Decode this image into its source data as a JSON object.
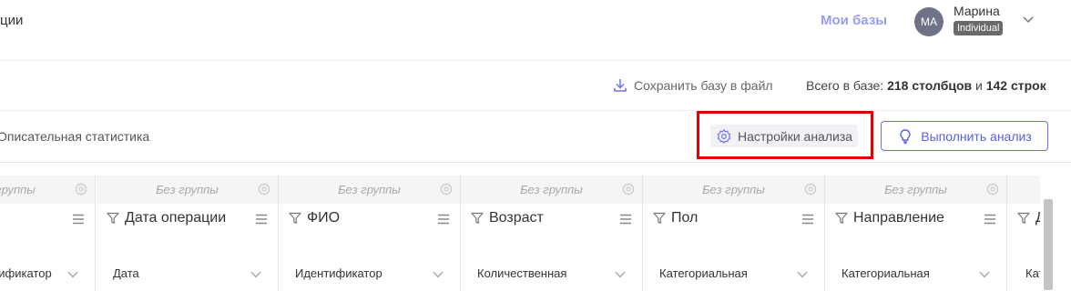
{
  "header": {
    "nav_fragment": "ции",
    "my_databases": "Мои базы",
    "user": {
      "initials": "MA",
      "name": "Марина",
      "plan": "Individual"
    }
  },
  "infobar": {
    "save_label": "Сохранить базу в файл",
    "totals_prefix": "Всего в базе: ",
    "totals_columns": "218 столбцов",
    "totals_and": " и ",
    "totals_rows": "142 строк"
  },
  "toolbar": {
    "title": "Описательная статистика",
    "settings_label": "Настройки анализа",
    "run_label": "Выполнить анализ"
  },
  "columns": [
    {
      "group": "Без группы",
      "name": "",
      "type": "Идентификатор"
    },
    {
      "group": "Без группы",
      "name": "Дата операции",
      "type": "Дата"
    },
    {
      "group": "Без группы",
      "name": "ФИО",
      "type": "Идентификатор"
    },
    {
      "group": "Без группы",
      "name": "Возраст",
      "type": "Количественная"
    },
    {
      "group": "Без группы",
      "name": "Пол",
      "type": "Категориальная"
    },
    {
      "group": "Без группы",
      "name": "Направление",
      "type": "Категориальная"
    },
    {
      "group": "",
      "name": "Д",
      "type": "Кат"
    }
  ],
  "colors": {
    "accent": "#5a5ee0",
    "highlight": "#e00000",
    "my_db": "#9b9cf5"
  },
  "icons": [
    "download-icon",
    "gear-icon",
    "lightbulb-icon",
    "filter-icon",
    "menu-icon",
    "chevron-down-icon"
  ]
}
